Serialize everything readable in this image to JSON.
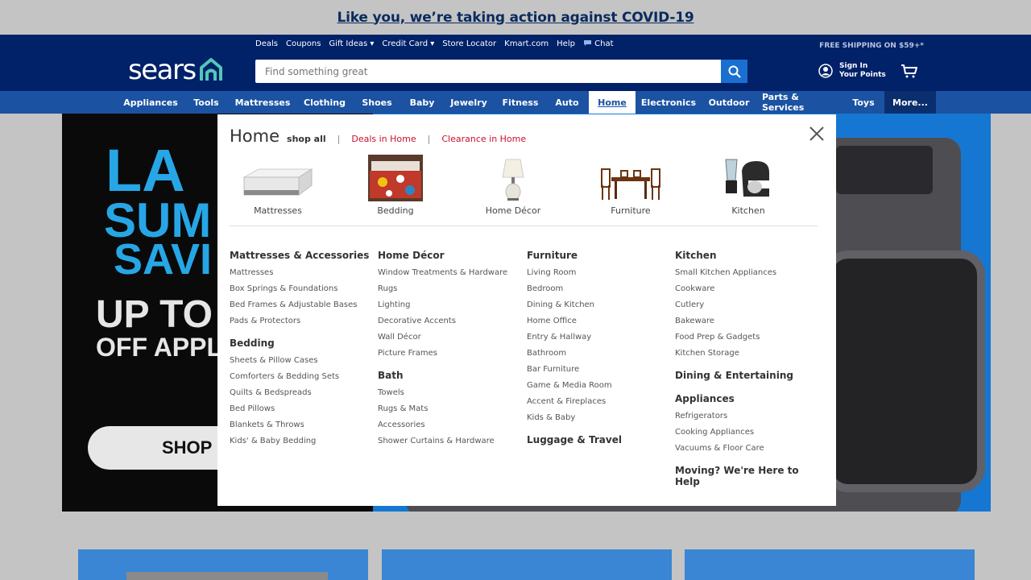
{
  "banner": {
    "text": "Like you, we’re taking action against COVID-19"
  },
  "header": {
    "logo": "sears",
    "util_links": [
      "Deals",
      "Coupons",
      "Gift Ideas ▾",
      "Credit Card ▾",
      "Store Locator",
      "Kmart.com",
      "Help",
      "Chat"
    ],
    "free_shipping": "FREE SHIPPING ON $59+*",
    "search_placeholder": "Find something great",
    "sign_in": "Sign In",
    "your_points": "Your Points"
  },
  "nav": {
    "items": [
      "Appliances",
      "Tools",
      "Mattresses",
      "Clothing",
      "Shoes",
      "Baby",
      "Jewelry",
      "Fitness",
      "Auto",
      "Home",
      "Electronics",
      "Outdoor",
      "Parts & Services",
      "Toys",
      "More..."
    ],
    "active": "Home"
  },
  "hero": {
    "line1": "LA",
    "line2": "SUM",
    "line3": "SAVI",
    "line4": "UP TO",
    "line5": "OFF APPL",
    "shop_button": "SHOP"
  },
  "menu": {
    "title": "Home",
    "shop_all": "shop all",
    "separator": "|",
    "deals_link": "Deals in Home",
    "clearance_link": "Clearance in Home",
    "featured": [
      "Mattresses",
      "Bedding",
      "Home Décor",
      "Furniture",
      "Kitchen"
    ],
    "columns": [
      [
        {
          "heading": "Mattresses & Accessories",
          "links": [
            "Mattresses",
            "Box Springs & Foundations",
            "Bed Frames & Adjustable Bases",
            "Pads & Protectors"
          ]
        },
        {
          "heading": "Bedding",
          "links": [
            "Sheets & Pillow Cases",
            "Comforters & Bedding Sets",
            "Quilts & Bedspreads",
            "Bed Pillows",
            "Blankets & Throws",
            "Kids' & Baby Bedding"
          ]
        }
      ],
      [
        {
          "heading": "Home Décor",
          "links": [
            "Window Treatments & Hardware",
            "Rugs",
            "Lighting",
            "Decorative Accents",
            "Wall Décor",
            "Picture Frames"
          ]
        },
        {
          "heading": "Bath",
          "links": [
            "Towels",
            "Rugs & Mats",
            "Accessories",
            "Shower Curtains & Hardware"
          ]
        }
      ],
      [
        {
          "heading": "Furniture",
          "links": [
            "Living Room",
            "Bedroom",
            "Dining & Kitchen",
            "Home Office",
            "Entry & Hallway",
            "Bathroom",
            "Bar Furniture",
            "Game & Media Room",
            "Accent & Fireplaces",
            "Kids & Baby"
          ]
        },
        {
          "heading": "Luggage & Travel",
          "links": []
        }
      ],
      [
        {
          "heading": "Kitchen",
          "links": [
            "Small Kitchen Appliances",
            "Cookware",
            "Cutlery",
            "Bakeware",
            "Food Prep & Gadgets",
            "Kitchen Storage"
          ]
        },
        {
          "heading": "Dining & Entertaining",
          "links": []
        },
        {
          "heading": "Appliances",
          "links": [
            "Refrigerators",
            "Cooking Appliances",
            "Vacuums & Floor Care"
          ]
        },
        {
          "heading": "Moving? We're Here to Help",
          "links": []
        }
      ]
    ]
  },
  "colors": {
    "header_bg": "#012169",
    "nav_bg": "#1b52a2",
    "accent_red": "#c8102e",
    "search_btn": "#1a6fd1"
  }
}
